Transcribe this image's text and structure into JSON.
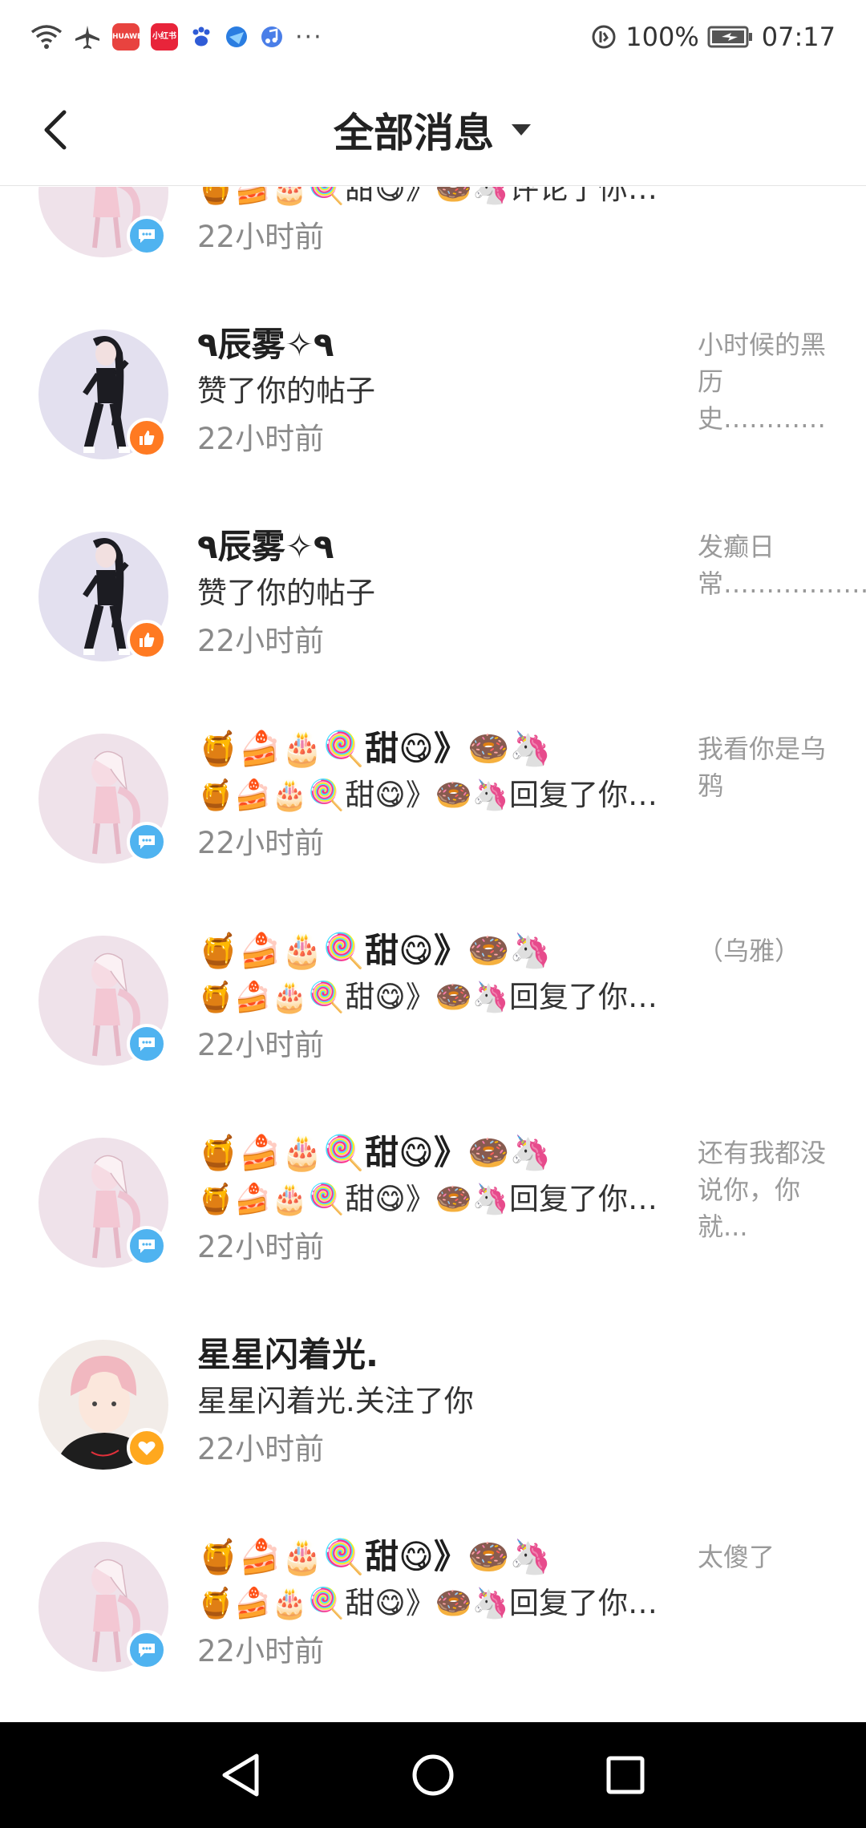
{
  "status_bar": {
    "battery": "100%",
    "time": "07:17",
    "app_badges": [
      "HUAWEI",
      "小红书"
    ]
  },
  "header": {
    "title": "全部消息"
  },
  "items": [
    {
      "name": "",
      "action": "🍯🍰🎂🍭甜😋》🍩🦄评论了你的帖子",
      "time": "22小时前",
      "preview": "",
      "badge": "comment",
      "avatar": "pink-girl"
    },
    {
      "name": "٩辰雾✧٩",
      "action": "赞了你的帖子",
      "time": "22小时前",
      "preview": "小时候的黑历史…………",
      "badge": "like",
      "avatar": "dark-girl"
    },
    {
      "name": "٩辰雾✧٩",
      "action": "赞了你的帖子",
      "time": "22小时前",
      "preview": "发癫日常…………………",
      "badge": "like",
      "avatar": "dark-girl"
    },
    {
      "name": "🍯🍰🎂🍭甜😋》🍩🦄",
      "action": "🍯🍰🎂🍭甜😋》🍩🦄回复了你的评论",
      "time": "22小时前",
      "preview": "我看你是乌鸦",
      "badge": "comment",
      "avatar": "pink-girl"
    },
    {
      "name": "🍯🍰🎂🍭甜😋》🍩🦄",
      "action": "🍯🍰🎂🍭甜😋》🍩🦄回复了你的评论",
      "time": "22小时前",
      "preview": "（乌雅）",
      "badge": "comment",
      "avatar": "pink-girl"
    },
    {
      "name": "🍯🍰🎂🍭甜😋》🍩🦄",
      "action": "🍯🍰🎂🍭甜😋》🍩🦄回复了你的评论",
      "time": "22小时前",
      "preview": "还有我都没说你，你就...",
      "badge": "comment",
      "avatar": "pink-girl"
    },
    {
      "name": "星星闪着光.",
      "action": "星星闪着光.关注了你",
      "time": "22小时前",
      "preview": "",
      "badge": "follow",
      "avatar": "boy"
    },
    {
      "name": "🍯🍰🎂🍭甜😋》🍩🦄",
      "action": "🍯🍰🎂🍭甜😋》🍩🦄回复了你的评论",
      "time": "22小时前",
      "preview": "太傻了",
      "badge": "comment",
      "avatar": "pink-girl"
    }
  ],
  "colors": {
    "comment_badge": "#4fb3f0",
    "like_badge": "#ff7a22",
    "follow_badge": "#ffa81e",
    "nav_bar": "#000000"
  }
}
